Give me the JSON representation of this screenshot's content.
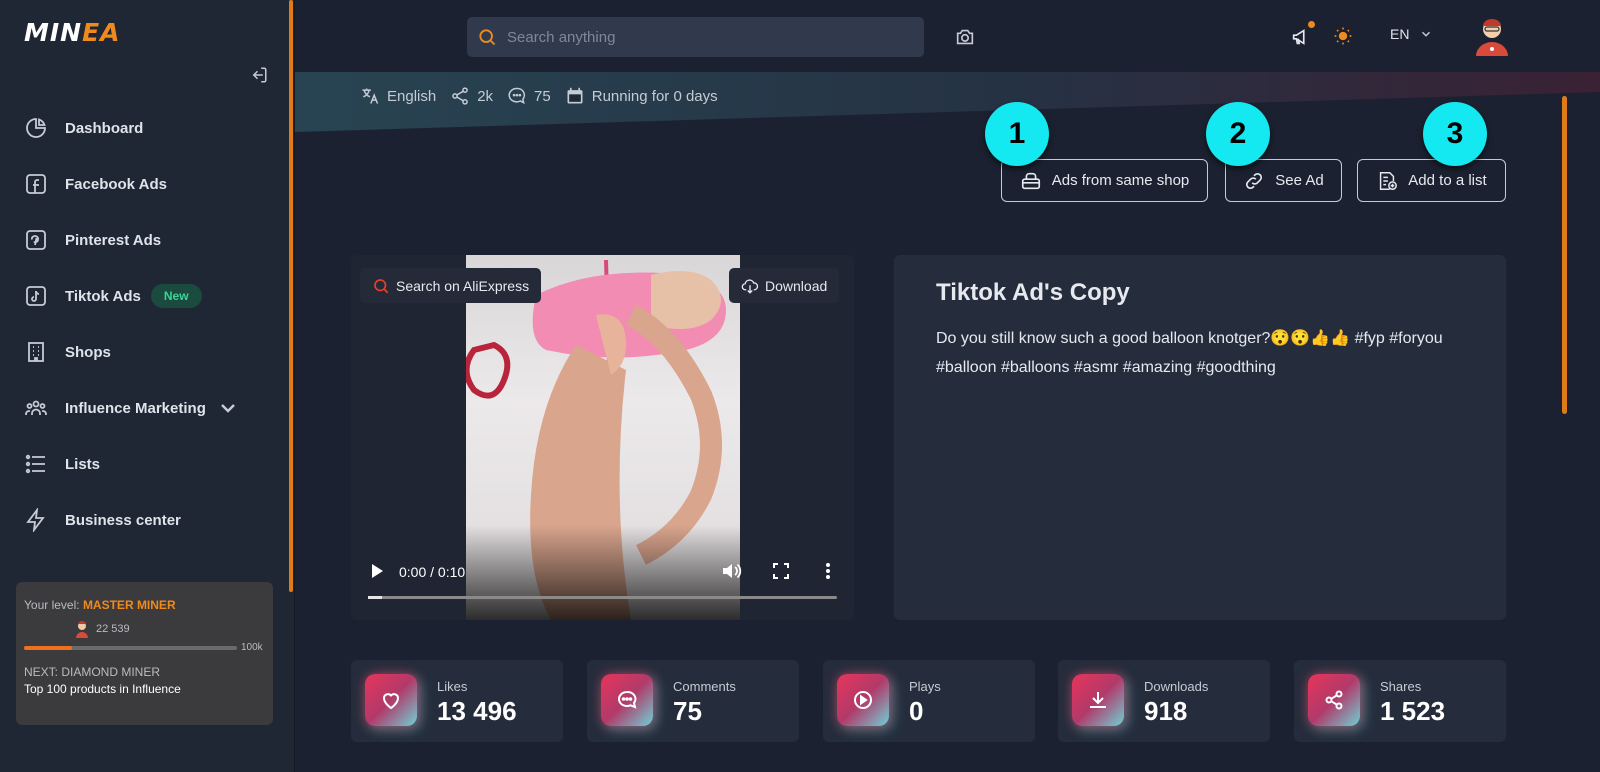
{
  "brand": {
    "logo_main": "MIN",
    "logo_accent": "EA"
  },
  "sidebar": {
    "items": [
      {
        "label": "Dashboard"
      },
      {
        "label": "Facebook Ads"
      },
      {
        "label": "Pinterest Ads"
      },
      {
        "label": "Tiktok Ads",
        "badge": "New"
      },
      {
        "label": "Shops"
      },
      {
        "label": "Influence Marketing"
      },
      {
        "label": "Lists"
      },
      {
        "label": "Business center"
      }
    ],
    "level": {
      "prefix": "Your level:",
      "name": "MASTER MINER",
      "points": "22 539",
      "max": "100k",
      "progress_fraction": 0.225,
      "next": "NEXT: DIAMOND MINER",
      "next_desc": "Top 100 products in Influence"
    }
  },
  "topbar": {
    "search_placeholder": "Search anything",
    "language": "EN"
  },
  "ad_meta": {
    "language": "English",
    "shares_short": "2k",
    "comments_short": "75",
    "running": "Running for 0 days"
  },
  "actions": {
    "same_shop": "Ads from same shop",
    "see_ad": "See Ad",
    "add_list": "Add to a list"
  },
  "markers": [
    "1",
    "2",
    "3"
  ],
  "video": {
    "search_label": "Search on AliExpress",
    "download_label": "Download",
    "time": "0:00 / 0:10"
  },
  "copy": {
    "title": "Tiktok Ad's Copy",
    "text": "Do you still know such a good balloon knotger?😯😯👍👍 #fyp #foryou #balloon #balloons #asmr #amazing #goodthing"
  },
  "stats": [
    {
      "label": "Likes",
      "value": "13 496"
    },
    {
      "label": "Comments",
      "value": "75"
    },
    {
      "label": "Plays",
      "value": "0"
    },
    {
      "label": "Downloads",
      "value": "918"
    },
    {
      "label": "Shares",
      "value": "1 523"
    }
  ],
  "colors": {
    "accent": "#f08a1c",
    "marker": "#14e8f0",
    "badge_bg": "#1b4a3e",
    "badge_text": "#3fd39a",
    "stat_gradient_start": "#e8345a",
    "stat_gradient_end": "#6fd0d6"
  }
}
